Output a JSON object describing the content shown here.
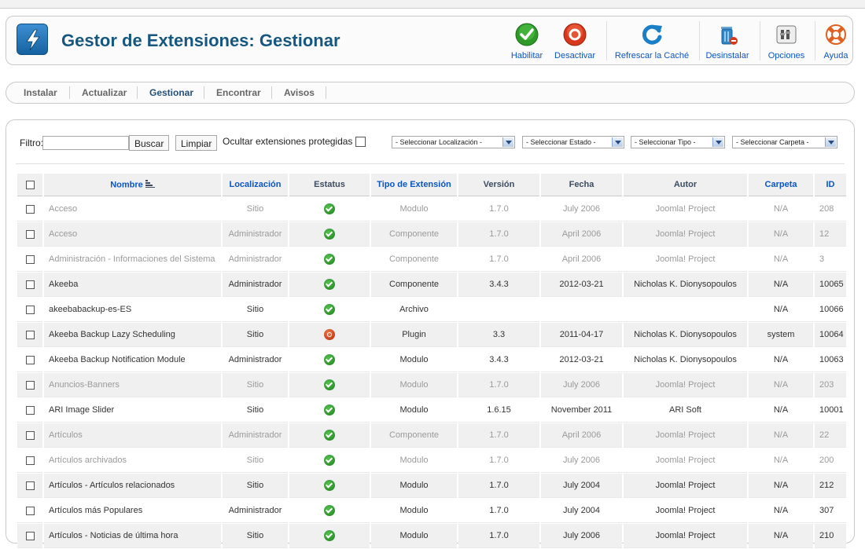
{
  "header": {
    "title": "Gestor de Extensiones: Gestionar"
  },
  "toolbar": {
    "buttons": [
      {
        "id": "enable",
        "label": "Habilitar",
        "icon": "check-circle-icon"
      },
      {
        "id": "disable",
        "label": "Desactivar",
        "icon": "stop-circle-icon"
      },
      {
        "id": "refresh",
        "label": "Refrescar la Caché",
        "icon": "refresh-icon"
      },
      {
        "id": "uninstall",
        "label": "Desinstalar",
        "icon": "trash-icon"
      },
      {
        "id": "options",
        "label": "Opciones",
        "icon": "options-icon"
      },
      {
        "id": "help",
        "label": "Ayuda",
        "icon": "lifebuoy-icon"
      }
    ]
  },
  "submenu": {
    "items": [
      {
        "label": "Instalar",
        "active": false
      },
      {
        "label": "Actualizar",
        "active": false
      },
      {
        "label": "Gestionar",
        "active": true
      },
      {
        "label": "Encontrar",
        "active": false
      },
      {
        "label": "Avisos",
        "active": false
      }
    ]
  },
  "filter": {
    "label": "Filtro:",
    "value": "",
    "search_button": "Buscar",
    "clear_button": "Limpiar",
    "hide_protected_label": "Ocultar extensiones protegidas",
    "selects": {
      "location": "- Seleccionar Localización -",
      "status": "- Seleccionar Estado -",
      "type": "- Seleccionar Tipo -",
      "folder": "- Seleccionar Carpeta -"
    }
  },
  "table": {
    "columns": [
      "Nombre",
      "Localización",
      "Estatus",
      "Tipo de Extensión",
      "Versión",
      "Fecha",
      "Autor",
      "Carpeta",
      "ID"
    ],
    "rows": [
      {
        "name": "Acceso",
        "location": "Sitio",
        "status": "enabled",
        "type": "Modulo",
        "version": "1.7.0",
        "date": "July 2006",
        "author": "Joomla! Project",
        "folder": "N/A",
        "id": "208",
        "protected": true
      },
      {
        "name": "Acceso",
        "location": "Administrador",
        "status": "enabled",
        "type": "Componente",
        "version": "1.7.0",
        "date": "April 2006",
        "author": "Joomla! Project",
        "folder": "N/A",
        "id": "12",
        "protected": true
      },
      {
        "name": "Administración - Informaciones del Sistema",
        "location": "Administrador",
        "status": "enabled",
        "type": "Componente",
        "version": "1.7.0",
        "date": "April 2006",
        "author": "Joomla! Project",
        "folder": "N/A",
        "id": "3",
        "protected": true
      },
      {
        "name": "Akeeba",
        "location": "Administrador",
        "status": "enabled",
        "type": "Componente",
        "version": "3.4.3",
        "date": "2012-03-21",
        "author": "Nicholas K. Dionysopoulos",
        "folder": "N/A",
        "id": "10065",
        "protected": false
      },
      {
        "name": "akeebabackup-es-ES",
        "location": "Sitio",
        "status": "enabled",
        "type": "Archivo",
        "version": "",
        "date": "",
        "author": "",
        "folder": "N/A",
        "id": "10066",
        "protected": false
      },
      {
        "name": "Akeeba Backup Lazy Scheduling",
        "location": "Sitio",
        "status": "disabled",
        "type": "Plugin",
        "version": "3.3",
        "date": "2011-04-17",
        "author": "Nicholas K. Dionysopoulos",
        "folder": "system",
        "id": "10064",
        "protected": false
      },
      {
        "name": "Akeeba Backup Notification Module",
        "location": "Administrador",
        "status": "enabled",
        "type": "Modulo",
        "version": "3.4.3",
        "date": "2012-03-21",
        "author": "Nicholas K. Dionysopoulos",
        "folder": "N/A",
        "id": "10063",
        "protected": false
      },
      {
        "name": "Anuncios-Banners",
        "location": "Sitio",
        "status": "enabled",
        "type": "Modulo",
        "version": "1.7.0",
        "date": "July 2006",
        "author": "Joomla! Project",
        "folder": "N/A",
        "id": "203",
        "protected": true
      },
      {
        "name": "ARI Image Slider",
        "location": "Sitio",
        "status": "enabled",
        "type": "Modulo",
        "version": "1.6.15",
        "date": "November 2011",
        "author": "ARI Soft",
        "folder": "N/A",
        "id": "10001",
        "protected": false
      },
      {
        "name": "Artículos",
        "location": "Administrador",
        "status": "enabled",
        "type": "Componente",
        "version": "1.7.0",
        "date": "April 2006",
        "author": "Joomla! Project",
        "folder": "N/A",
        "id": "22",
        "protected": true
      },
      {
        "name": "Artículos archivados",
        "location": "Sitio",
        "status": "enabled",
        "type": "Modulo",
        "version": "1.7.0",
        "date": "July 2006",
        "author": "Joomla! Project",
        "folder": "N/A",
        "id": "200",
        "protected": true
      },
      {
        "name": "Artículos - Artículos relacionados",
        "location": "Sitio",
        "status": "enabled",
        "type": "Modulo",
        "version": "1.7.0",
        "date": "July 2004",
        "author": "Joomla! Project",
        "folder": "N/A",
        "id": "212",
        "protected": false
      },
      {
        "name": "Artículos más Populares",
        "location": "Administrador",
        "status": "enabled",
        "type": "Modulo",
        "version": "1.7.0",
        "date": "July 2004",
        "author": "Joomla! Project",
        "folder": "N/A",
        "id": "307",
        "protected": false
      },
      {
        "name": "Artículos - Noticias de última hora",
        "location": "Sitio",
        "status": "enabled",
        "type": "Modulo",
        "version": "1.7.0",
        "date": "July 2006",
        "author": "Joomla! Project",
        "folder": "N/A",
        "id": "210",
        "protected": false
      }
    ]
  },
  "colors": {
    "title": "#15577f",
    "link": "#0b55c4",
    "enabled": "#2b8f28",
    "disabled": "#c9441a"
  }
}
